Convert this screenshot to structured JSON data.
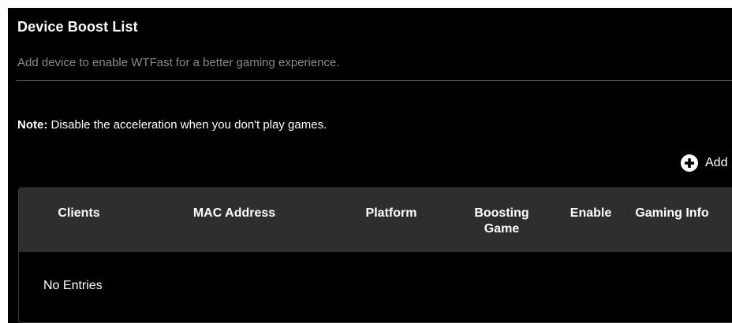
{
  "header": {
    "title": "Device Boost List",
    "subtitle": "Add device to enable WTFast for a better gaming experience."
  },
  "note": {
    "label": "Note:",
    "text": " Disable the acceleration when you don't play games."
  },
  "add_button": {
    "label": "Add",
    "icon": "plus-circle-icon"
  },
  "table": {
    "columns": [
      "Clients",
      "MAC Address",
      "Platform",
      "Boosting Game",
      "Enable",
      "Gaming Info"
    ],
    "empty_message": "No Entries"
  },
  "colors": {
    "background": "#000000",
    "header_row": "#2e2e2e",
    "subtitle": "#8a8a8a",
    "text": "#ffffff"
  }
}
